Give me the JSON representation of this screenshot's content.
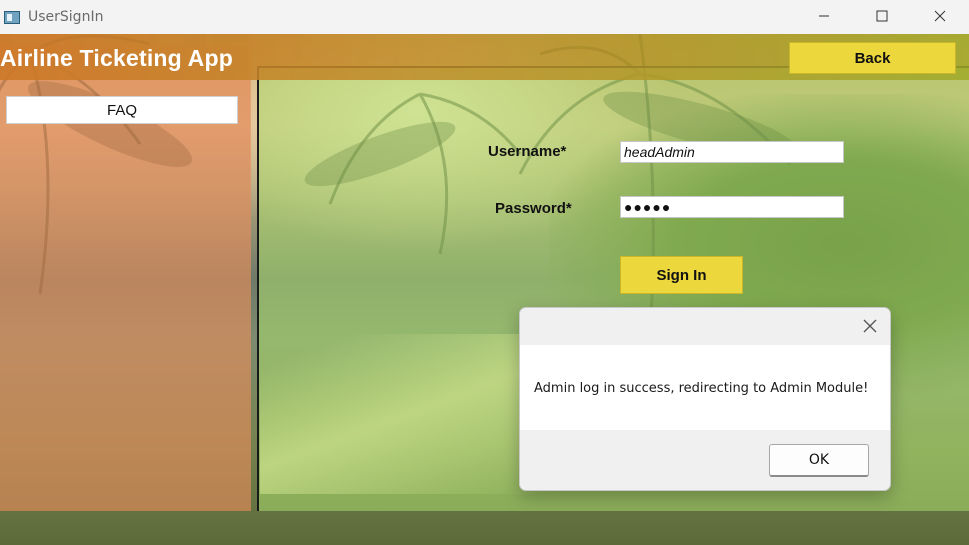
{
  "window": {
    "title": "UserSignIn",
    "icon": "app-window-icon",
    "controls": [
      "minimize-icon",
      "maximize-icon",
      "close-icon"
    ]
  },
  "header": {
    "title": "Airline Ticketing App",
    "back_label": "Back"
  },
  "sidebar": {
    "faq_label": "FAQ"
  },
  "form": {
    "username_label": "Username*",
    "username_value": "headAdmin",
    "password_label": "Password*",
    "password_value": "●●●●●",
    "signin_label": "Sign In"
  },
  "dialog": {
    "message": "Admin log in success, redirecting to Admin Module!",
    "ok_label": "OK",
    "close_icon": "close-icon"
  },
  "colors": {
    "accent_button": "#ecd73d",
    "header_band": "#cd7828",
    "left_tint": "#e88c5a",
    "right_tint": "#aadc6e"
  }
}
